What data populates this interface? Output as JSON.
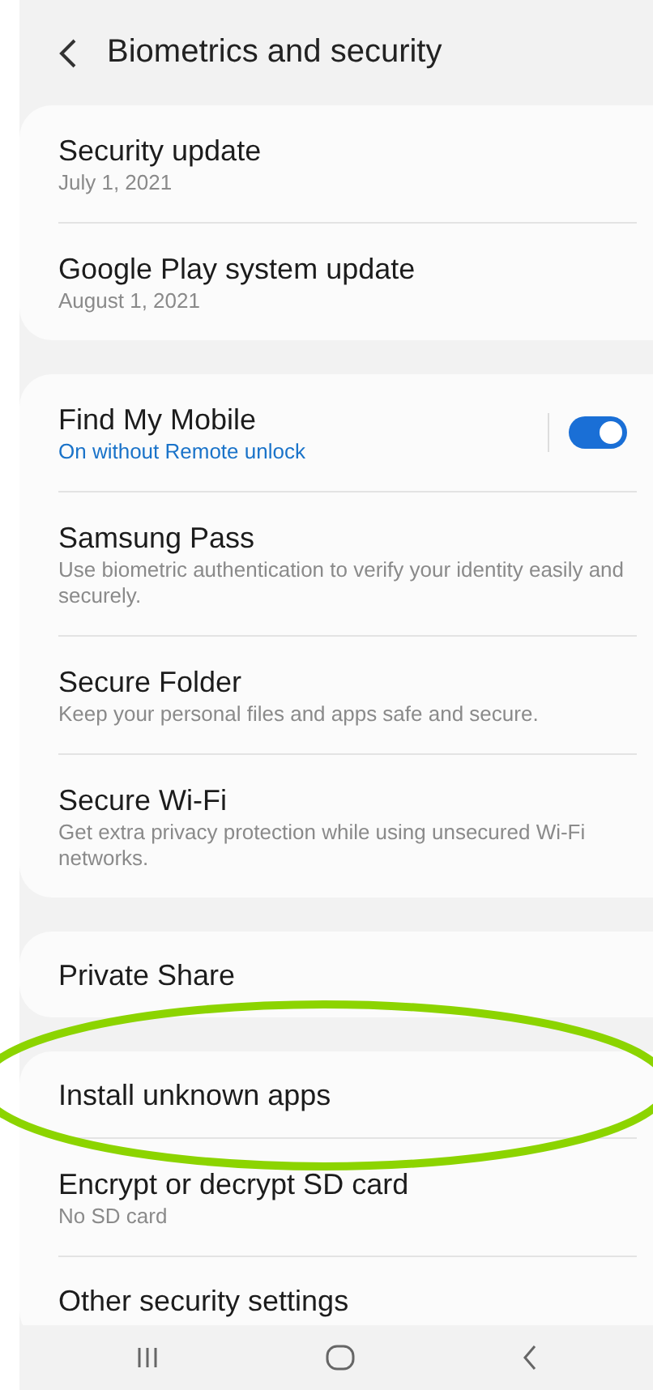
{
  "header": {
    "title": "Biometrics and security"
  },
  "cards": [
    {
      "items": [
        {
          "kind": "plain",
          "title": "Security update",
          "subtitle": "July 1, 2021"
        },
        {
          "kind": "plain",
          "title": "Google Play system update",
          "subtitle": "August 1, 2021"
        }
      ]
    },
    {
      "items": [
        {
          "kind": "toggle",
          "title": "Find My Mobile",
          "status": "On without Remote unlock",
          "on": true
        },
        {
          "kind": "plain",
          "title": "Samsung Pass",
          "subtitle": "Use biometric authentication to verify your identity easily and securely."
        },
        {
          "kind": "plain",
          "title": "Secure Folder",
          "subtitle": "Keep your personal files and apps safe and secure."
        },
        {
          "kind": "plain",
          "title": "Secure Wi-Fi",
          "subtitle": "Get extra privacy protection while using unsecured Wi-Fi networks."
        }
      ]
    },
    {
      "items": [
        {
          "kind": "plain",
          "title": "Private Share"
        }
      ]
    },
    {
      "items": [
        {
          "kind": "plain",
          "title": "Install unknown apps"
        },
        {
          "kind": "plain",
          "title": "Encrypt or decrypt SD card",
          "subtitle": "No SD card"
        },
        {
          "kind": "plain",
          "title": "Other security settings"
        }
      ]
    }
  ],
  "annotation": {
    "kind": "ellipse",
    "color": "#8cd400"
  }
}
